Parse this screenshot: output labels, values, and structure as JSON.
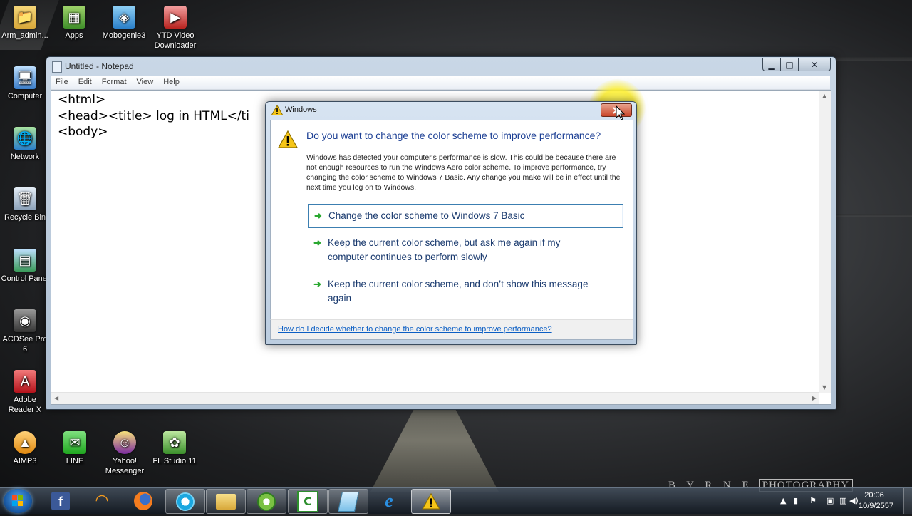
{
  "desktop": {
    "icons": [
      {
        "label": "Arm_admin...",
        "icon": "folder-icon"
      },
      {
        "label": "Apps",
        "icon": "apps-icon"
      },
      {
        "label": "Mobogenie3",
        "icon": "mobogenie-icon"
      },
      {
        "label": "YTD Video Downloader",
        "icon": "ytd-icon"
      },
      {
        "label": "Computer",
        "icon": "computer-icon"
      },
      {
        "label": "Network",
        "icon": "network-icon"
      },
      {
        "label": "Recycle Bin",
        "icon": "recycle-bin-icon"
      },
      {
        "label": "Control Panel",
        "icon": "control-panel-icon"
      },
      {
        "label": "ACDSee Pro 6",
        "icon": "acdsee-icon"
      },
      {
        "label": "Adobe Reader X",
        "icon": "adobe-reader-icon"
      },
      {
        "label": "AIMP3",
        "icon": "aimp-icon"
      },
      {
        "label": "LINE",
        "icon": "line-icon"
      },
      {
        "label": "Yahoo! Messenger",
        "icon": "yahoo-messenger-icon"
      },
      {
        "label": "FL Studio 11",
        "icon": "fl-studio-icon"
      }
    ],
    "watermark": {
      "left": "B Y R N E",
      "box": "PHOTOGRAPHY"
    }
  },
  "notepad": {
    "title": "Untitled - Notepad",
    "menu": [
      "File",
      "Edit",
      "Format",
      "View",
      "Help"
    ],
    "content": "<html>\n<head><title> log in HTML</ti\n<body>"
  },
  "dialog": {
    "title": "Windows",
    "heading": "Do you want to change the color scheme to improve performance?",
    "description": "Windows has detected your computer's performance is slow. This could be because there are not enough resources to run the Windows Aero color scheme. To improve performance, try changing the color scheme to Windows 7 Basic. Any change you make will be in effect until the next time you log on to Windows.",
    "options": [
      "Change the color scheme to Windows 7 Basic",
      "Keep the current color scheme, but ask me again if my computer continues to perform slowly",
      "Keep the current color scheme, and don’t show this message again"
    ],
    "help_link": "How do I decide whether to change the color scheme to improve performance?"
  },
  "taskbar": {
    "items": [
      "ie-icon",
      "facebook-icon",
      "wifi-app-icon",
      "firefox-icon",
      "skype-icon",
      "explorer-icon",
      "media-player-icon",
      "camtasia-icon",
      "notepad-icon",
      "internet-explorer-icon",
      "warning-icon"
    ],
    "clock_time": "20:06",
    "clock_date": "10/9/2557"
  },
  "colors": {
    "accent_blue": "#1c3f94",
    "link": "#0b5ec4",
    "arrow_green": "#2aa830",
    "highlight": "#fff35a"
  }
}
